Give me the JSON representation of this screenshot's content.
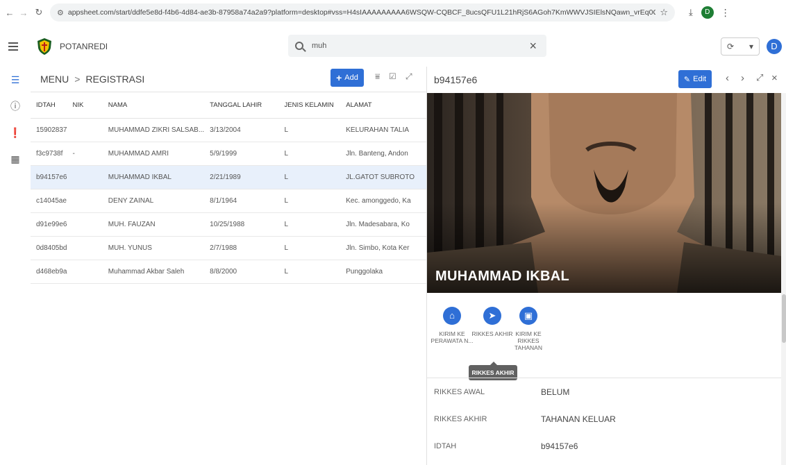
{
  "browser": {
    "url": "appsheet.com/start/ddfe5e8d-f4b6-4d84-ae3b-87958a74a2a9?platform=desktop#vss=H4sIAAAAAAAAA6WSQW-CQBCF_8ucsQFU1L21hRjS6AGoh7KmWWVJSIElsNQawn_vrEq0QfR2-5jvpc3j23gO...",
    "profile_initial": "D"
  },
  "app": {
    "name": "POTANREDI",
    "search_value": "muh",
    "avatar_initial": "D"
  },
  "rail": {
    "items": [
      "list-icon",
      "info-icon",
      "alert-icon",
      "grid-icon"
    ]
  },
  "list": {
    "breadcrumb_root": "MENU",
    "breadcrumb_sep": ">",
    "breadcrumb_current": "REGISTRASI",
    "add_label": "Add",
    "columns": [
      "IDTAH",
      "NIK",
      "NAMA",
      "TANGGAL LAHIR",
      "JENIS KELAMIN",
      "ALAMAT"
    ],
    "rows": [
      {
        "idtah": "15902837",
        "nik": "",
        "nama": "MUHAMMAD ZIKRI SALSAB...",
        "tgl": "3/13/2004",
        "jk": "L",
        "alamat": "KELURAHAN TALIA"
      },
      {
        "idtah": "f3c9738f",
        "nik": "-",
        "nama": "MUHAMMAD AMRI",
        "tgl": "5/9/1999",
        "jk": "L",
        "alamat": "Jln. Banteng, Andon"
      },
      {
        "idtah": "b94157e6",
        "nik": "",
        "nama": "MUHAMMAD IKBAL",
        "tgl": "2/21/1989",
        "jk": "L",
        "alamat": "JL.GATOT SUBROTO"
      },
      {
        "idtah": "c14045ae",
        "nik": "",
        "nama": "DENY ZAINAL",
        "tgl": "8/1/1964",
        "jk": "L",
        "alamat": "Kec. amonggedo, Ka"
      },
      {
        "idtah": "d91e99e6",
        "nik": "",
        "nama": "MUH. FAUZAN",
        "tgl": "10/25/1988",
        "jk": "L",
        "alamat": "Jln. Madesabara, Ko"
      },
      {
        "idtah": "0d8405bd",
        "nik": "",
        "nama": "MUH. YUNUS",
        "tgl": "2/7/1988",
        "jk": "L",
        "alamat": "Jln. Simbo, Kota Ker"
      },
      {
        "idtah": "d468eb9a",
        "nik": "",
        "nama": "Muhammad Akbar Saleh",
        "tgl": "8/8/2000",
        "jk": "L",
        "alamat": "Punggolaka"
      }
    ],
    "selected_index": 2
  },
  "detail": {
    "title": "b94157e6",
    "edit_label": "Edit",
    "photo_name": "MUHAMMAD IKBAL",
    "actions": [
      {
        "label": "KIRIM KE PERAWATA N...",
        "icon": "home-icon"
      },
      {
        "label": "RIKKES AKHIR",
        "icon": "send-icon"
      },
      {
        "label": "KIRIM KE RIKKES TAHANAN",
        "icon": "building-icon"
      }
    ],
    "tooltip": "RIKKES AKHIR",
    "fields": [
      {
        "label": "RIKKES AWAL",
        "value": "BELUM"
      },
      {
        "label": "RIKKES AKHIR",
        "value": "TAHANAN KELUAR"
      },
      {
        "label": "IDTAH",
        "value": "b94157e6"
      }
    ]
  },
  "colors": {
    "accent": "#2f6fd6",
    "selected_row": "#e8f0fb"
  }
}
